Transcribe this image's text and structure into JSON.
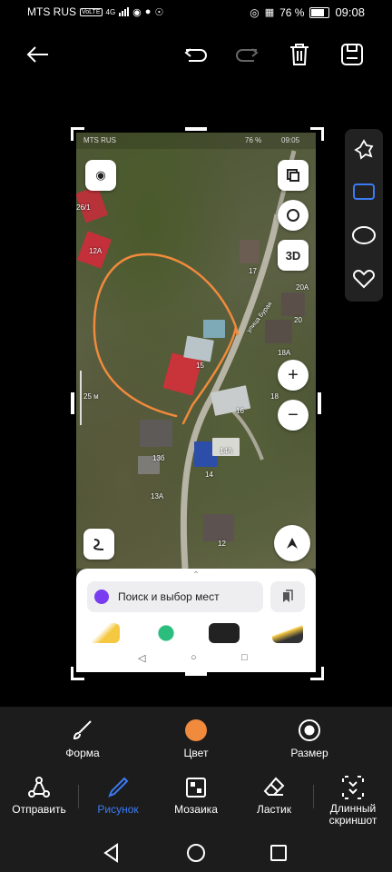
{
  "status_bar": {
    "carrier": "MTS RUS",
    "volte": "VoLTE",
    "network": "4G",
    "battery": "76 %",
    "time": "09:08"
  },
  "toolbar": {
    "back_icon": "arrow-left-icon",
    "undo_icon": "undo-icon",
    "redo_icon": "redo-icon",
    "delete_icon": "trash-icon",
    "save_icon": "save-icon"
  },
  "screenshot": {
    "inner_status": {
      "carrier": "MTS RUS",
      "battery": "76 %",
      "time": "09:05"
    },
    "map_labels": [
      "26/1",
      "12A",
      "17",
      "20A",
      "20",
      "18A",
      "15",
      "18",
      "16",
      "14A",
      "14",
      "13б",
      "13A",
      "12"
    ],
    "street_label": "улица Бурая",
    "scale_label": "25 м",
    "map_buttons": {
      "layers": "layers-icon",
      "rotate": "rotate-icon",
      "three_d": "3D",
      "zoom_in": "+",
      "zoom_out": "−",
      "route": "route-icon",
      "compass": "compass-icon"
    },
    "search_placeholder": "Поиск и выбор мест",
    "annotation_color": "#f08a3c"
  },
  "shape_panel": {
    "items": [
      "freeform-icon",
      "rectangle-icon",
      "circle-icon",
      "heart-icon"
    ],
    "selected": "rectangle-icon"
  },
  "edit_options": [
    {
      "label": "Форма",
      "icon": "brush-icon"
    },
    {
      "label": "Цвет",
      "icon": "color-dot-icon",
      "color": "#f08a3c"
    },
    {
      "label": "Размер",
      "icon": "size-icon"
    }
  ],
  "tools": [
    {
      "label": "Отправить",
      "icon": "share-icon"
    },
    {
      "label": "Рисунок",
      "icon": "pen-icon",
      "active": true
    },
    {
      "label": "Мозаика",
      "icon": "mosaic-icon"
    },
    {
      "label": "Ластик",
      "icon": "eraser-icon"
    },
    {
      "label": "Длинный скриншот",
      "icon": "scroll-capture-icon"
    }
  ],
  "accent_color": "#3b7bf5"
}
